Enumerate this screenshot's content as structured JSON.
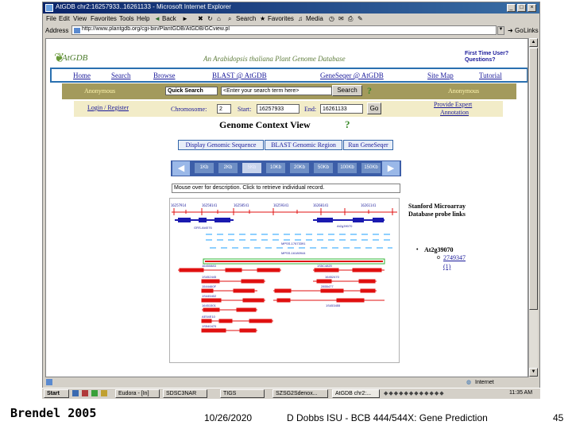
{
  "window": {
    "title": "AtGDB chr2:16257933..16261133 - Microsoft Internet Explorer",
    "menu": [
      "File",
      "Edit",
      "View",
      "Favorites",
      "Tools",
      "Help"
    ],
    "toolbar": [
      "Back",
      "Search",
      "Favorites",
      "Media"
    ],
    "address_label": "Address",
    "address": "http://www.plantgdb.org/cgi-bin/PlantGDB/AtGDB/GCview.pl",
    "go_label": "Go",
    "links_label": "Links",
    "status": "Internet"
  },
  "site": {
    "logo": "AtGDB",
    "banner": "An Arabidopsis thaliana Plant Genome Database",
    "first_time": "First Time User?",
    "questions": "Questions?",
    "nav": [
      "Home",
      "Search",
      "Browse",
      "BLAST @ AtGDB",
      "GeneSeqer @ AtGDB",
      "Site Map",
      "Tutorial"
    ],
    "anon_left": "Anonymous",
    "anon_right": "Anonymous",
    "quick_search": "Quick Search",
    "search_placeholder": "<Enter your search term here>",
    "search_btn": "Search",
    "login": "Login / Register",
    "chromosome_label": "Chromosome:",
    "chromosome_value": "2",
    "start_label": "Start:",
    "start_value": "16257933",
    "end_label": "End:",
    "end_value": "16261133",
    "go_btn": "Go",
    "expert_line1": "Provide Expert",
    "expert_line2": "Annotation"
  },
  "gcv": {
    "title": "Genome Context View",
    "tabs": [
      "Display Genomic Sequence",
      "BLAST Genomic Region",
      "Run GeneSeqer"
    ],
    "zoom": [
      "1Kb",
      "2Kb",
      "5Kb",
      "10Kb",
      "20Kb",
      "50Kb",
      "100Kb",
      "150Kb"
    ],
    "info": "Mouse over for description. Click to retrieve individual record.",
    "stanford_line1": "Stanford Microarray",
    "stanford_line2": "Database probe links",
    "gene": "At2g39070",
    "probe": "2749347",
    "probe_count": "(1)"
  },
  "taskbar": {
    "start": "Start",
    "tasks": [
      "Eudora - [In]",
      "SDSC3NAR",
      "TIGS",
      "SZSG2Sdenox...",
      "AtGDB chr2:..."
    ],
    "clock": "11:35 AM"
  },
  "footer": {
    "author": "Brendel 2005",
    "date": "10/26/2020",
    "course": "D Dobbs ISU - BCB 444/544X: Gene Prediction",
    "page": "45"
  },
  "colors": {
    "titlebar": "#0a246a",
    "olive": "#a39a5c",
    "nav_border": "#2a70b0",
    "gene_blue": "#1a1ab0",
    "est_red": "#e01010",
    "probe_lightblue": "#8fd0ff"
  }
}
